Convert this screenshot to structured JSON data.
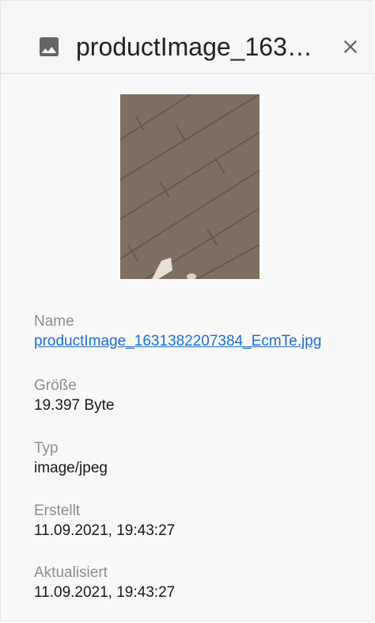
{
  "header": {
    "title": "productImage_1631382207384_EcmTe.jpg",
    "icon": "image-icon",
    "close_icon": "close-icon"
  },
  "preview": {
    "alt": "Produktbild"
  },
  "details": {
    "name_label": "Name",
    "name_value": "productImage_1631382207384_EcmTe.jpg",
    "size_label": "Größe",
    "size_value": "19.397 Byte",
    "type_label": "Typ",
    "type_value": "image/jpeg",
    "created_label": "Erstellt",
    "created_value": "11.09.2021, 19:43:27",
    "updated_label": "Aktualisiert",
    "updated_value": "11.09.2021, 19:43:27"
  },
  "colors": {
    "link": "#1f6ed6",
    "label": "#8d8d8d",
    "icon": "#666666"
  }
}
